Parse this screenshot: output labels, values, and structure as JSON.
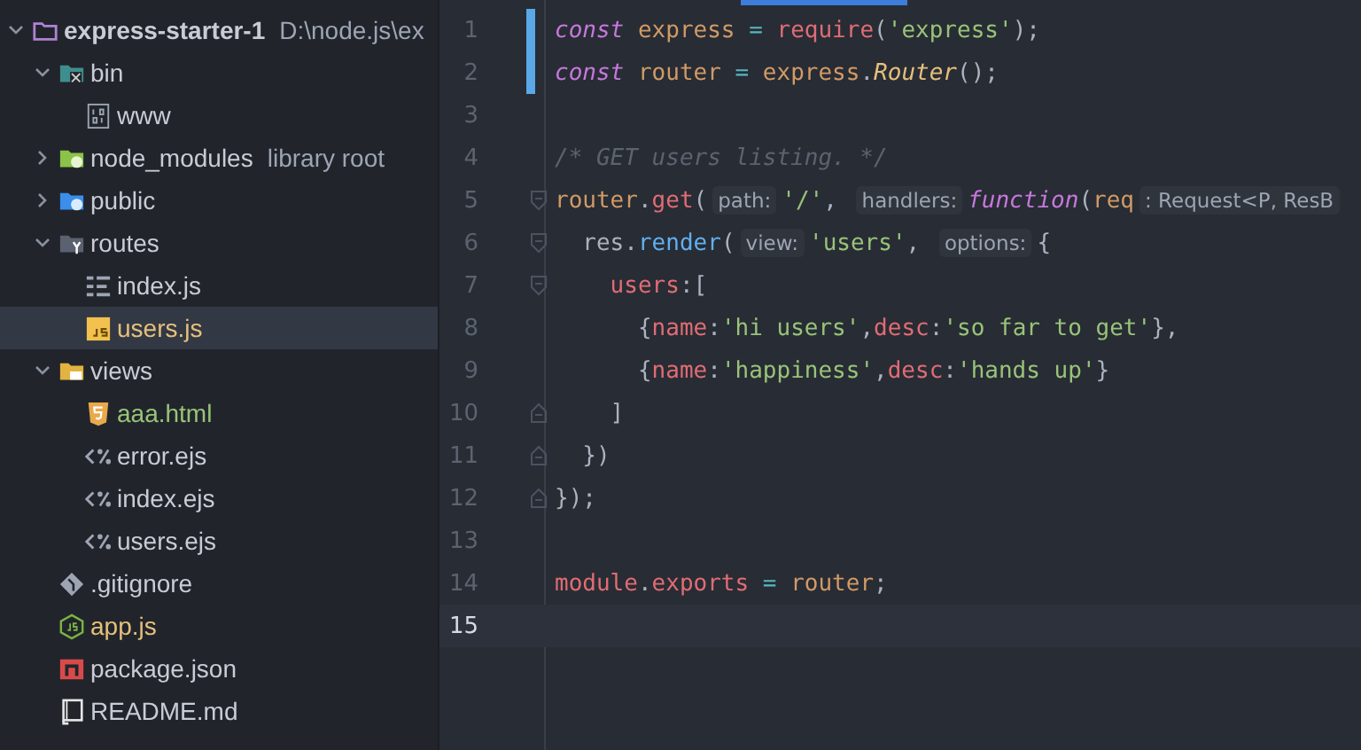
{
  "project_tree": {
    "items": [
      {
        "label": "express-starter-1",
        "note": "D:\\node.js\\ex",
        "kind": "project-folder",
        "expanded": true,
        "selected": false,
        "children": [
          {
            "label": "bin",
            "kind": "bin-folder",
            "expanded": true,
            "selected": false,
            "children": [
              {
                "label": "www",
                "kind": "binary-file",
                "selected": false
              }
            ]
          },
          {
            "label": "node_modules",
            "note": "library root",
            "kind": "node-folder",
            "expanded": false,
            "selected": false
          },
          {
            "label": "public",
            "kind": "web-folder",
            "expanded": false,
            "selected": false
          },
          {
            "label": "routes",
            "kind": "routes-folder",
            "expanded": true,
            "selected": false,
            "children": [
              {
                "label": "index.js",
                "kind": "outline-file",
                "selected": false
              },
              {
                "label": "users.js",
                "kind": "js-file",
                "selected": true,
                "color": "#e5c07b"
              }
            ]
          },
          {
            "label": "views",
            "kind": "views-folder",
            "expanded": true,
            "selected": false,
            "children": [
              {
                "label": "aaa.html",
                "kind": "html-file",
                "selected": false,
                "color": "#98c379"
              },
              {
                "label": "error.ejs",
                "kind": "ejs-file",
                "selected": false
              },
              {
                "label": "index.ejs",
                "kind": "ejs-file",
                "selected": false
              },
              {
                "label": "users.ejs",
                "kind": "ejs-file",
                "selected": false
              }
            ]
          },
          {
            "label": ".gitignore",
            "kind": "git-file",
            "selected": false
          },
          {
            "label": "app.js",
            "kind": "node-file",
            "selected": false,
            "color": "#e5c07b"
          },
          {
            "label": "package.json",
            "kind": "npm-file",
            "selected": false
          },
          {
            "label": "README.md",
            "kind": "readme-file",
            "selected": false
          }
        ]
      }
    ]
  },
  "editor": {
    "lines": [
      {
        "number": "1",
        "changed": true,
        "current": false,
        "tokens": [
          {
            "kind": "kw",
            "text": "const "
          },
          {
            "kind": "id",
            "text": "express"
          },
          {
            "kind": "op",
            "text": " = "
          },
          {
            "kind": "fn",
            "text": "require"
          },
          {
            "kind": "p",
            "text": "("
          },
          {
            "kind": "str",
            "text": "'express'"
          },
          {
            "kind": "p",
            "text": ");"
          }
        ]
      },
      {
        "number": "2",
        "changed": true,
        "current": false,
        "tokens": [
          {
            "kind": "kw",
            "text": "const "
          },
          {
            "kind": "id",
            "text": "router"
          },
          {
            "kind": "op",
            "text": " = "
          },
          {
            "kind": "id",
            "text": "express"
          },
          {
            "kind": "p",
            "text": "."
          },
          {
            "kind": "cls",
            "text": "Router"
          },
          {
            "kind": "p",
            "text": "();"
          }
        ]
      },
      {
        "number": "3",
        "changed": false,
        "current": false
      },
      {
        "number": "4",
        "changed": false,
        "current": false,
        "tokens": [
          {
            "kind": "cm",
            "text": "/* GET users listing. */"
          }
        ]
      },
      {
        "number": "5",
        "changed": false,
        "current": false,
        "fold_start": true,
        "fold_end": false,
        "tokens": [
          {
            "kind": "id",
            "text": "router"
          },
          {
            "kind": "p",
            "text": "."
          },
          {
            "kind": "fn",
            "text": "get"
          },
          {
            "kind": "p",
            "text": "("
          },
          {
            "kind": "hint",
            "text": "path:"
          },
          {
            "kind": "str",
            "text": "'/'"
          },
          {
            "kind": "p",
            "text": ", "
          },
          {
            "kind": "hint",
            "text": "handlers:"
          },
          {
            "kind": "kw",
            "text": "function"
          },
          {
            "kind": "p",
            "text": "("
          },
          {
            "kind": "id",
            "text": "req"
          },
          {
            "kind": "hint",
            "text": ": Request<P, ResB"
          }
        ]
      },
      {
        "number": "6",
        "changed": false,
        "current": false,
        "fold_start": true,
        "fold_end": false,
        "tokens": [
          {
            "kind": "p",
            "text": "  res."
          },
          {
            "kind": "m",
            "text": "render"
          },
          {
            "kind": "p",
            "text": "("
          },
          {
            "kind": "hint",
            "text": "view:"
          },
          {
            "kind": "str",
            "text": "'users'"
          },
          {
            "kind": "p",
            "text": ", "
          },
          {
            "kind": "hint",
            "text": "options:"
          },
          {
            "kind": "p",
            "text": "{"
          }
        ]
      },
      {
        "number": "7",
        "changed": false,
        "current": false,
        "fold_start": true,
        "fold_end": false,
        "tokens": [
          {
            "kind": "fn",
            "text": "    users"
          },
          {
            "kind": "p",
            "text": ":["
          }
        ]
      },
      {
        "number": "8",
        "changed": false,
        "current": false,
        "tokens": [
          {
            "kind": "p",
            "text": "      {"
          },
          {
            "kind": "fn",
            "text": "name"
          },
          {
            "kind": "p",
            "text": ":"
          },
          {
            "kind": "str",
            "text": "'hi users'"
          },
          {
            "kind": "p",
            "text": ","
          },
          {
            "kind": "fn",
            "text": "desc"
          },
          {
            "kind": "p",
            "text": ":"
          },
          {
            "kind": "str",
            "text": "'so far to get'"
          },
          {
            "kind": "p",
            "text": "},"
          }
        ]
      },
      {
        "number": "9",
        "changed": false,
        "current": false,
        "tokens": [
          {
            "kind": "p",
            "text": "      {"
          },
          {
            "kind": "fn",
            "text": "name"
          },
          {
            "kind": "p",
            "text": ":"
          },
          {
            "kind": "str",
            "text": "'happiness'"
          },
          {
            "kind": "p",
            "text": ","
          },
          {
            "kind": "fn",
            "text": "desc"
          },
          {
            "kind": "p",
            "text": ":"
          },
          {
            "kind": "str",
            "text": "'hands up'"
          },
          {
            "kind": "p",
            "text": "}"
          }
        ]
      },
      {
        "number": "10",
        "changed": false,
        "current": false,
        "fold_start": false,
        "fold_end": true,
        "tokens": [
          {
            "kind": "p",
            "text": "    ]"
          }
        ]
      },
      {
        "number": "11",
        "changed": false,
        "current": false,
        "fold_start": false,
        "fold_end": true,
        "tokens": [
          {
            "kind": "p",
            "text": "  })"
          }
        ]
      },
      {
        "number": "12",
        "changed": false,
        "current": false,
        "fold_start": false,
        "fold_end": true,
        "tokens": [
          {
            "kind": "p",
            "text": "});"
          }
        ]
      },
      {
        "number": "13",
        "changed": false,
        "current": false
      },
      {
        "number": "14",
        "changed": false,
        "current": false,
        "tokens": [
          {
            "kind": "fn",
            "text": "module"
          },
          {
            "kind": "p",
            "text": "."
          },
          {
            "kind": "fn",
            "text": "exports"
          },
          {
            "kind": "op",
            "text": " = "
          },
          {
            "kind": "id",
            "text": "router"
          },
          {
            "kind": "p",
            "text": ";"
          }
        ]
      },
      {
        "number": "15",
        "changed": false,
        "current": true
      }
    ]
  }
}
